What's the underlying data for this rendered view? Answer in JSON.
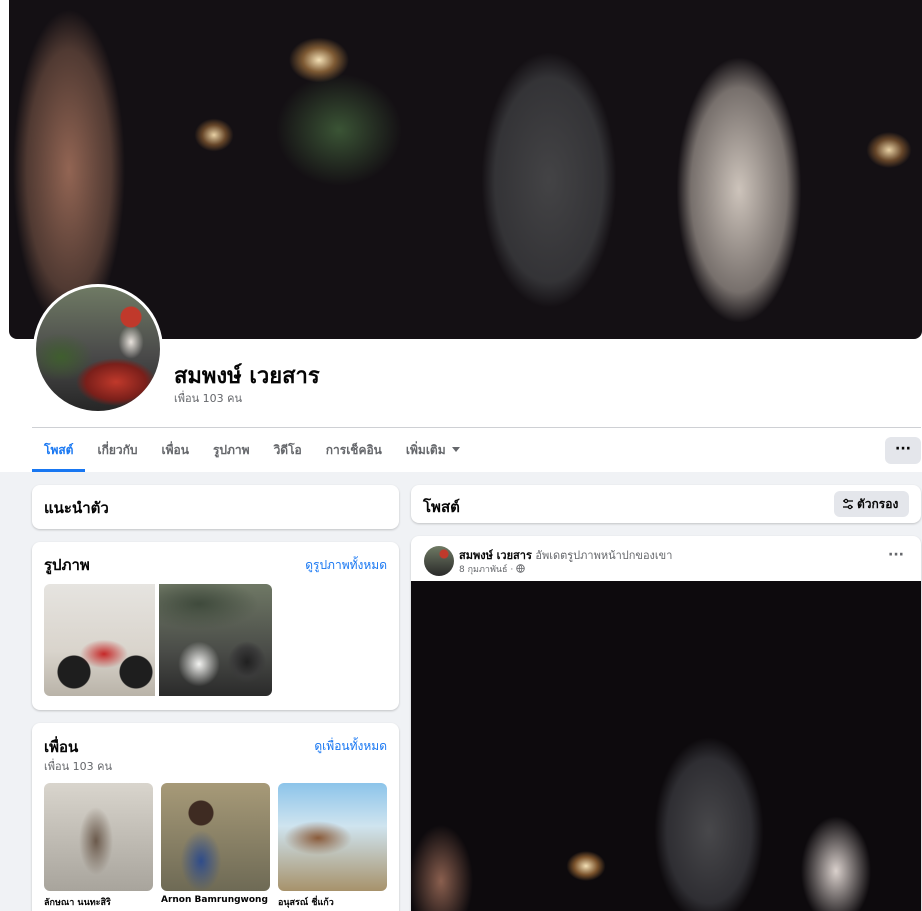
{
  "profile": {
    "name": "สมพงษ์ เวยสาร",
    "friends_count": "เพื่อน 103 คน"
  },
  "tabs": [
    {
      "label": "โพสต์",
      "active": true
    },
    {
      "label": "เกี่ยวกับ"
    },
    {
      "label": "เพื่อน"
    },
    {
      "label": "รูปภาพ"
    },
    {
      "label": "วิดีโอ"
    },
    {
      "label": "การเช็คอิน"
    },
    {
      "label": "เพิ่มเติม"
    }
  ],
  "more_button": "···",
  "intro": {
    "title": "แนะนำตัว"
  },
  "photos": {
    "title": "รูปภาพ",
    "see_all": "ดูรูปภาพทั้งหมด"
  },
  "friends": {
    "title": "เพื่อน",
    "count": "เพื่อน 103 คน",
    "see_all": "ดูเพื่อนทั้งหมด",
    "items": [
      {
        "name": "ลักษณา นนทะสิริ"
      },
      {
        "name": "Arnon Bamrungwong"
      },
      {
        "name": "อนุสรณ์ ชี่แก้ว"
      }
    ]
  },
  "posts_header": {
    "title": "โพสต์",
    "filter_label": "ตัวกรอง"
  },
  "post": {
    "author": "สมพงษ์ เวยสาร",
    "action": "อัพเดตรูปภาพหน้าปกของเขา",
    "date": "8 กุมภาพันธ์ ·",
    "more": "···"
  },
  "colors": {
    "accent": "#1877f2",
    "background": "#f0f2f5",
    "secondary_text": "#65676b"
  },
  "icons": {
    "privacy": "globe-icon",
    "filter": "sliders-icon",
    "dropdown": "caret-down-icon"
  }
}
